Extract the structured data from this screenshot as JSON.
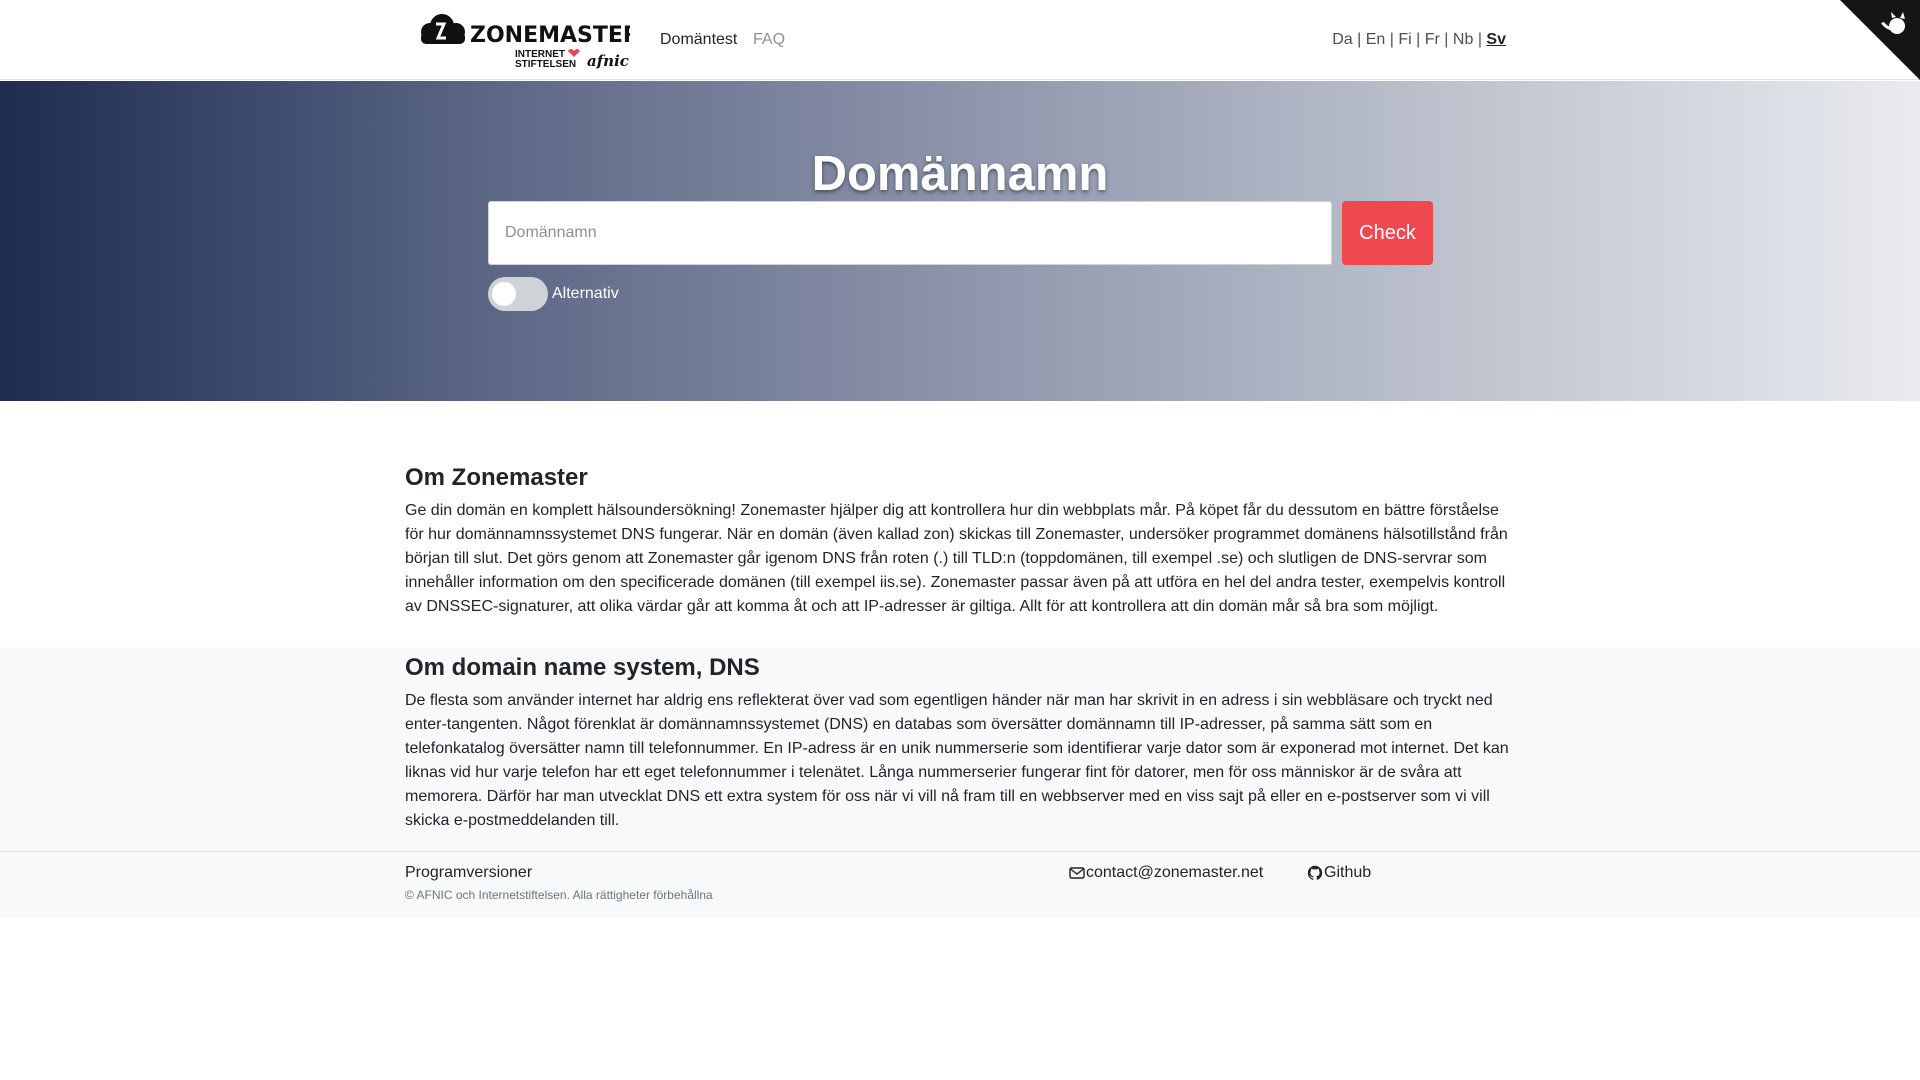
{
  "header": {
    "logo_text": "ZONEMASTER",
    "logo_sub1": "INTERNET",
    "logo_sub2": "STIFTELSEN",
    "logo_sub3": "afnic",
    "nav": [
      {
        "label": "Domäntest"
      },
      {
        "label": "FAQ"
      }
    ],
    "languages": [
      {
        "label": "Da"
      },
      {
        "label": "En"
      },
      {
        "label": "Fi"
      },
      {
        "label": "Fr"
      },
      {
        "label": "Nb"
      },
      {
        "label": "Sv",
        "active": true
      }
    ],
    "lang_separator": "|"
  },
  "hero": {
    "title": "Domännamn",
    "input_placeholder": "Domännamn",
    "input_value": "",
    "check_label": "Check",
    "options_toggle_label": "Alternativ",
    "options_toggle_on": false
  },
  "about": {
    "title": "Om Zonemaster",
    "text": "Ge din domän en komplett hälsoundersökning! Zonemaster hjälper dig att kontrollera hur din webbplats mår. På köpet får du dessutom en bättre förståelse för hur domännamnssystemet DNS fungerar. När en domän (även kallad zon) skickas till Zonemaster, undersöker programmet domänens hälsotillstånd från början till slut. Det görs genom att Zonemaster går igenom DNS från roten (.) till TLD:n (toppdomänen, till exempel .se) och slutligen de DNS-servrar som innehåller information om den specificerade domänen (till exempel iis.se). Zonemaster passar även på att utföra en hel del andra tester, exempelvis kontroll av DNSSEC-signaturer, att olika värdar går att komma åt och att IP-adresser är giltiga. Allt för att kontrollera att din domän mår så bra som möjligt."
  },
  "dns": {
    "title": "Om domain name system, DNS",
    "text": "De flesta som använder internet har aldrig ens reflekterat över vad som egentligen händer när man har skrivit in en adress i sin webbläsare och tryckt ned enter-tangenten. Något förenklat är domännamnssystemet (DNS) en databas som översätter domännamn till IP-adresser, på samma sätt som en telefonkatalog översätter namn till telefonnummer. En IP-adress är en unik nummerserie som identifierar varje dator som är exponerad mot internet. Det kan liknas vid hur varje telefon har ett eget telefonnummer i telenätet. Långa nummerserier fungerar fint för datorer, men för oss människor är de svåra att memorera. Därför har man utvecklat DNS ett extra system för oss när vi vill nå fram till en webbserver med en viss sajt på eller en e-postserver som vi vill skicka e-postmeddelanden till."
  },
  "footer": {
    "versions_label": "Programversioner",
    "copyright": "© AFNIC och Internetstiftelsen. Alla rättigheter förbehållna",
    "contact_email": "contact@zonemaster.net",
    "github_label": "Github",
    "contact_icon": "envelope-icon",
    "github_icon": "github-icon"
  },
  "colors": {
    "accent": "#f0484f",
    "hero_start": "#1e2c50",
    "hero_end": "#e9ebef",
    "section_alt_bg": "#f8f9fa"
  }
}
